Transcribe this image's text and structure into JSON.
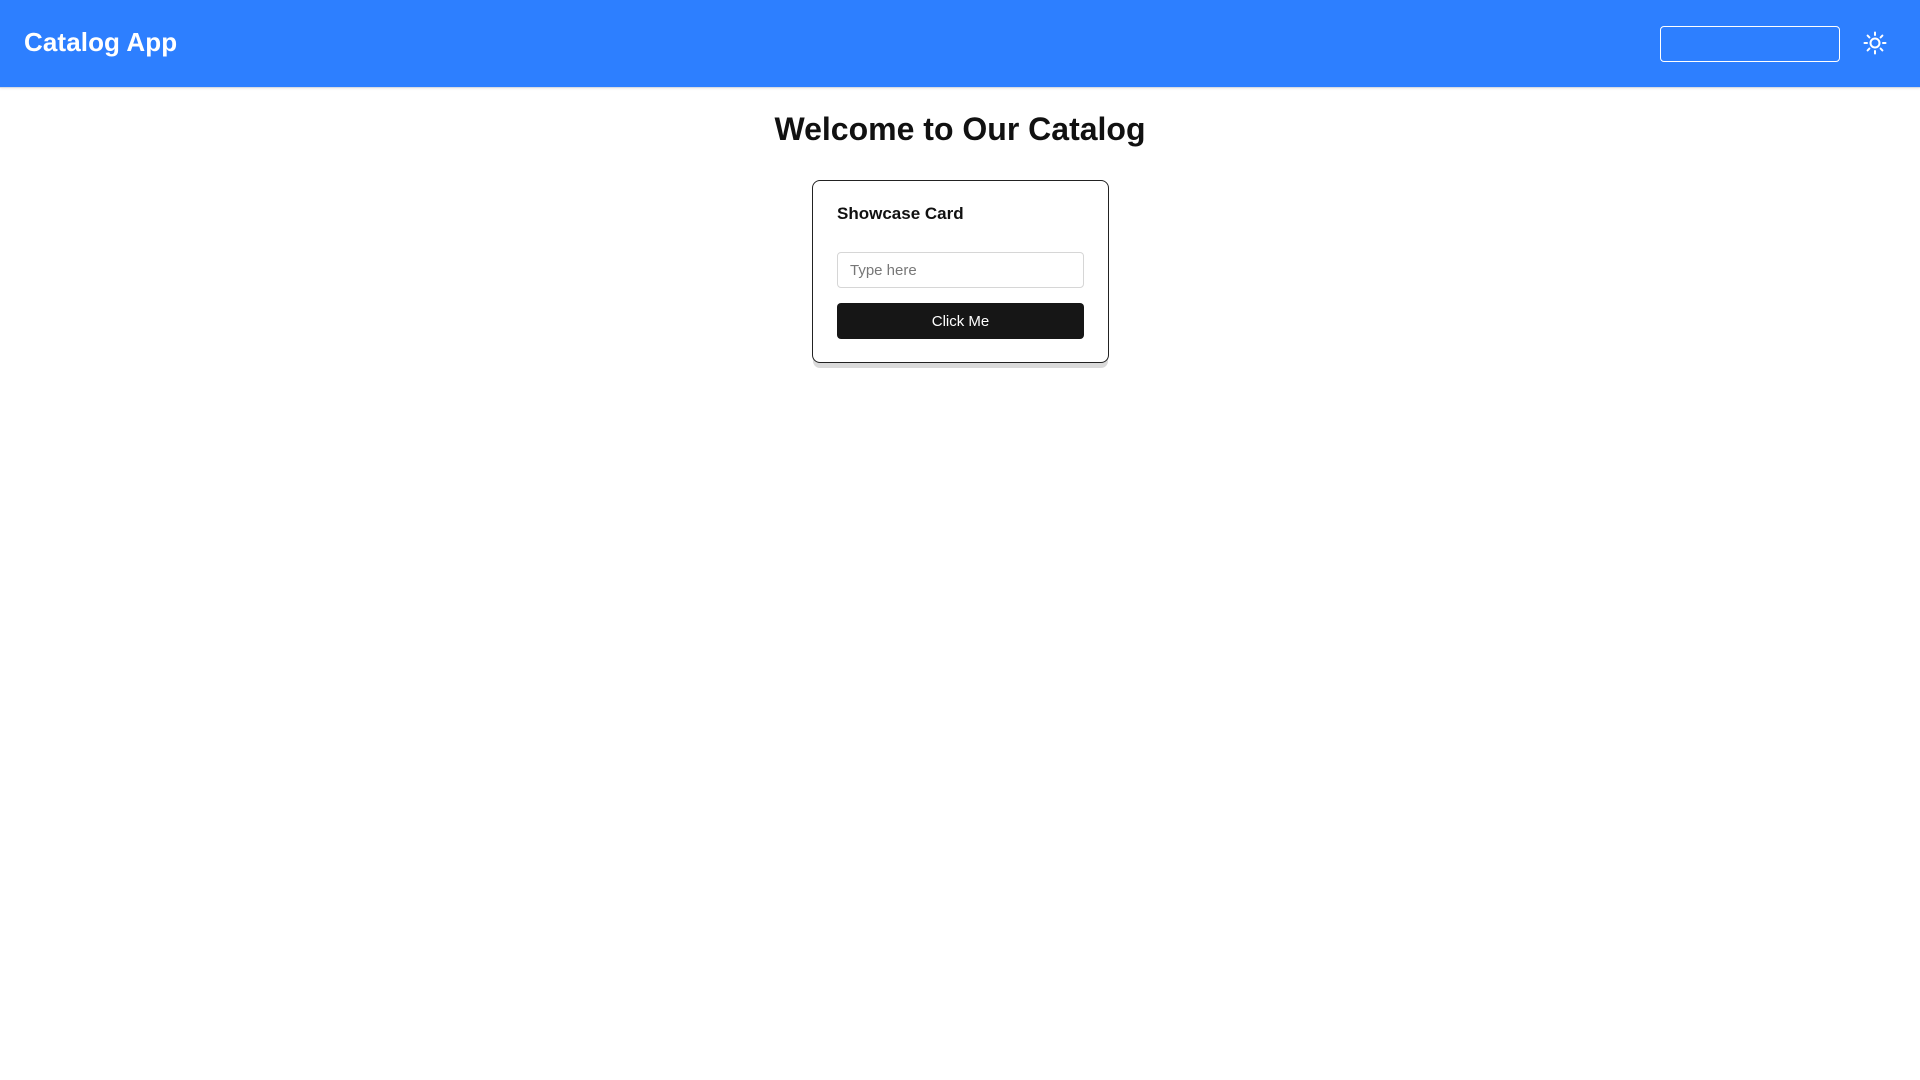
{
  "header": {
    "app_title": "Catalog App",
    "search_value": "",
    "theme_icon": "sun-icon",
    "background_color": "#2d7fff"
  },
  "main": {
    "page_title": "Welcome to Our Catalog",
    "card": {
      "title": "Showcase Card",
      "input_placeholder": "Type here",
      "input_value": "",
      "button_label": "Click Me",
      "button_color": "#161616"
    }
  }
}
